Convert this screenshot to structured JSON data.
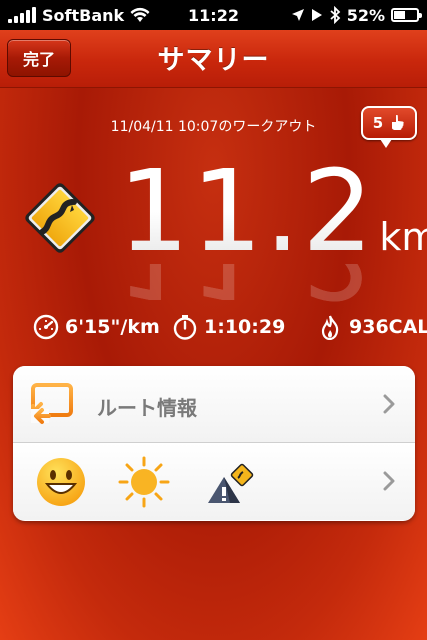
{
  "status_bar": {
    "carrier": "SoftBank",
    "time": "11:22",
    "battery_percent": "52%",
    "battery_level": 0.52,
    "icons": [
      "signal-bars-icon",
      "wifi-icon",
      "location-arrow-icon",
      "play-icon",
      "bluetooth-icon",
      "battery-icon"
    ]
  },
  "navbar": {
    "done_label": "完了",
    "title": "サマリー"
  },
  "summary": {
    "workout_date": "11/04/11 10:07のワークアウト",
    "likes_count": "5",
    "distance_value": "11.2",
    "distance_unit": "km"
  },
  "stats": {
    "pace": "6'15\"/km",
    "duration": "1:10:29",
    "calories": "936CAL"
  },
  "card": {
    "route_label": "ルート情報",
    "icons": [
      "route-screen-icon",
      "smile-face-icon",
      "sun-icon",
      "terrain-icon"
    ]
  },
  "colors": {
    "accent_red": "#e23a12",
    "nav_red": "#c9270c",
    "sign_yellow": "#f6c21a"
  }
}
